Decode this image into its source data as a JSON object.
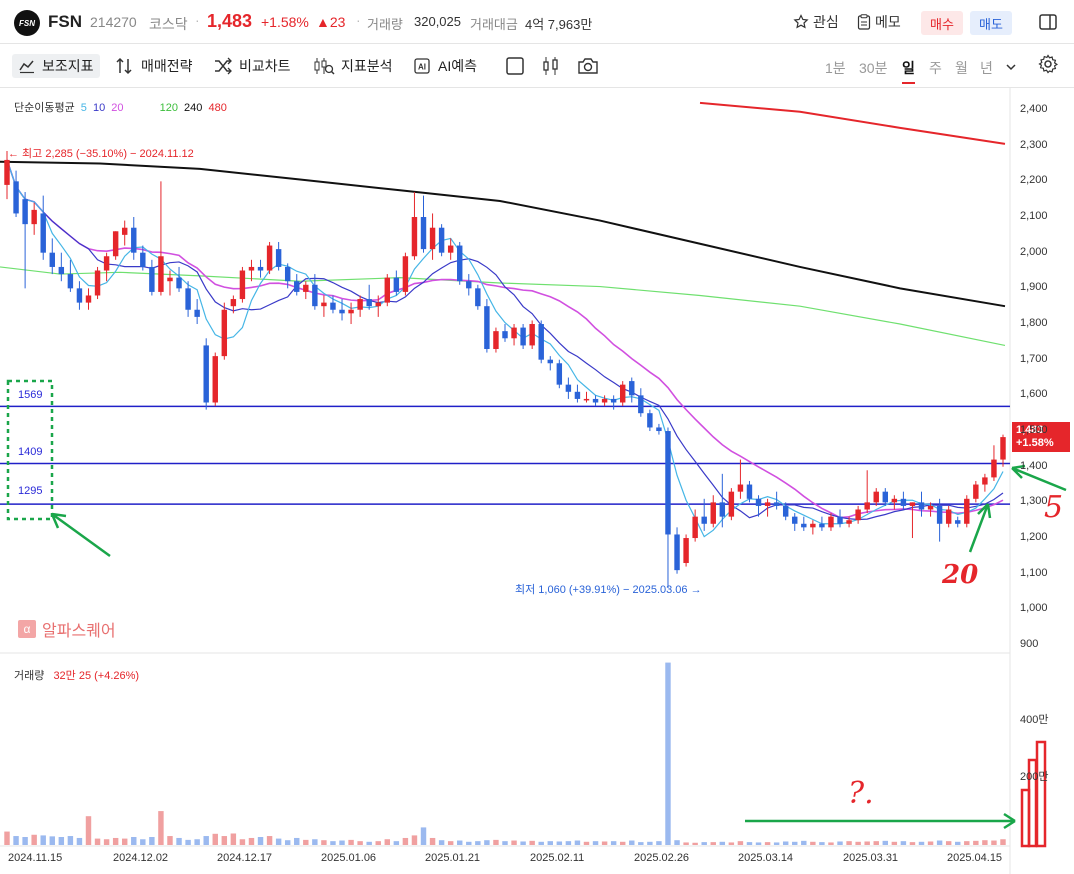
{
  "header": {
    "logo_text": "FSN",
    "name": "FSN",
    "code": "214270",
    "market": "코스닥",
    "price": "1,483",
    "change_pct": "+1.58%",
    "change_diff": "▲23",
    "volume_label": "거래량",
    "volume_value": "320,025",
    "amount_label": "거래대금",
    "amount_value": "4억 7,963만",
    "watch_label": "관심",
    "memo_label": "메모",
    "buy_label": "매수",
    "sell_label": "매도"
  },
  "toolbar": {
    "indicators_label": "보조지표",
    "strategy_label": "매매전략",
    "compare_label": "비교차트",
    "analysis_label": "지표분석",
    "ai_label": "AI예측",
    "periods": [
      "1분",
      "30분",
      "일",
      "주",
      "월",
      "년"
    ],
    "selected_period": "일"
  },
  "legend": {
    "ma_label": "단순이동평균",
    "ma_values": [
      "5",
      "10",
      "20",
      "120",
      "240",
      "480"
    ],
    "volume_label": "거래량",
    "volume_value": "32만 25 (+4.26%)"
  },
  "colors": {
    "up": "#e5262b",
    "down": "#2a63d8",
    "ma5": "#46b6e6",
    "ma10": "#3a3ac8",
    "ma20": "#d150e0",
    "ma120": "#6fe06f",
    "ma240": "#111111",
    "ma480": "#e5262b"
  },
  "annotations": {
    "high": "← 최고 2,285 (−35.10%) − 2024.11.12",
    "low": "최저 1,060 (+39.91%) − 2025.03.06 →",
    "level_1": "1569",
    "level_2": "1409",
    "level_3": "1295",
    "handwritten_5": "5",
    "handwritten_20": "20",
    "handwritten_q": "?.",
    "alpha_brand": "알파스퀘어",
    "alpha_icon": "α"
  },
  "price_tag": {
    "price": "1,483",
    "pct": "+1.58%"
  },
  "price_axis": [
    "2,400",
    "2,300",
    "2,200",
    "2,100",
    "2,000",
    "1,900",
    "1,800",
    "1,700",
    "1,600",
    "1,500",
    "1,400",
    "1,300",
    "1,200",
    "1,100",
    "1,000",
    "900"
  ],
  "volume_axis": [
    "400만",
    "200만"
  ],
  "date_axis": [
    "2024.11.15",
    "2024.12.02",
    "2024.12.17",
    "2025.01.06",
    "2025.01.21",
    "2025.02.11",
    "2025.02.26",
    "2025.03.14",
    "2025.03.31",
    "2025.04.15"
  ],
  "chart_data": {
    "type": "candlestick",
    "price_range": [
      900,
      2400
    ],
    "volume_range_man": [
      0,
      400
    ],
    "horizontal_levels": [
      1569,
      1409,
      1295
    ],
    "candles": [
      {
        "o": 2190,
        "h": 2285,
        "l": 2150,
        "c": 2260
      },
      {
        "o": 2200,
        "h": 2230,
        "l": 2100,
        "c": 2110
      },
      {
        "o": 2150,
        "h": 2170,
        "l": 1900,
        "c": 2080
      },
      {
        "o": 2080,
        "h": 2140,
        "l": 2050,
        "c": 2120
      },
      {
        "o": 2110,
        "h": 2160,
        "l": 1980,
        "c": 2000
      },
      {
        "o": 2000,
        "h": 2040,
        "l": 1940,
        "c": 1960
      },
      {
        "o": 1960,
        "h": 2000,
        "l": 1920,
        "c": 1940
      },
      {
        "o": 1940,
        "h": 1980,
        "l": 1890,
        "c": 1900
      },
      {
        "o": 1900,
        "h": 1920,
        "l": 1840,
        "c": 1860
      },
      {
        "o": 1860,
        "h": 1900,
        "l": 1840,
        "c": 1880
      },
      {
        "o": 1880,
        "h": 1960,
        "l": 1870,
        "c": 1950
      },
      {
        "o": 1950,
        "h": 2000,
        "l": 1920,
        "c": 1990
      },
      {
        "o": 1990,
        "h": 2060,
        "l": 1980,
        "c": 2060
      },
      {
        "o": 2050,
        "h": 2090,
        "l": 2020,
        "c": 2070
      },
      {
        "o": 2070,
        "h": 2100,
        "l": 1980,
        "c": 2000
      },
      {
        "o": 2000,
        "h": 2020,
        "l": 1950,
        "c": 1960
      },
      {
        "o": 1960,
        "h": 1980,
        "l": 1880,
        "c": 1890
      },
      {
        "o": 1890,
        "h": 2200,
        "l": 1880,
        "c": 1990
      },
      {
        "o": 1920,
        "h": 1950,
        "l": 1880,
        "c": 1930
      },
      {
        "o": 1930,
        "h": 1960,
        "l": 1890,
        "c": 1900
      },
      {
        "o": 1900,
        "h": 1920,
        "l": 1820,
        "c": 1840
      },
      {
        "o": 1840,
        "h": 1870,
        "l": 1800,
        "c": 1820
      },
      {
        "o": 1740,
        "h": 1760,
        "l": 1560,
        "c": 1580
      },
      {
        "o": 1580,
        "h": 1720,
        "l": 1570,
        "c": 1710
      },
      {
        "o": 1710,
        "h": 1860,
        "l": 1700,
        "c": 1840
      },
      {
        "o": 1850,
        "h": 1880,
        "l": 1830,
        "c": 1870
      },
      {
        "o": 1870,
        "h": 1960,
        "l": 1860,
        "c": 1950
      },
      {
        "o": 1950,
        "h": 1980,
        "l": 1920,
        "c": 1960
      },
      {
        "o": 1960,
        "h": 1980,
        "l": 1930,
        "c": 1950
      },
      {
        "o": 1950,
        "h": 2030,
        "l": 1940,
        "c": 2020
      },
      {
        "o": 2010,
        "h": 2030,
        "l": 1950,
        "c": 1960
      },
      {
        "o": 1960,
        "h": 1970,
        "l": 1900,
        "c": 1920
      },
      {
        "o": 1920,
        "h": 1940,
        "l": 1880,
        "c": 1890
      },
      {
        "o": 1890,
        "h": 1920,
        "l": 1870,
        "c": 1910
      },
      {
        "o": 1910,
        "h": 1940,
        "l": 1840,
        "c": 1850
      },
      {
        "o": 1850,
        "h": 1880,
        "l": 1820,
        "c": 1860
      },
      {
        "o": 1860,
        "h": 1880,
        "l": 1830,
        "c": 1840
      },
      {
        "o": 1840,
        "h": 1870,
        "l": 1810,
        "c": 1830
      },
      {
        "o": 1830,
        "h": 1860,
        "l": 1800,
        "c": 1840
      },
      {
        "o": 1840,
        "h": 1880,
        "l": 1820,
        "c": 1870
      },
      {
        "o": 1870,
        "h": 1910,
        "l": 1840,
        "c": 1850
      },
      {
        "o": 1850,
        "h": 1880,
        "l": 1820,
        "c": 1860
      },
      {
        "o": 1860,
        "h": 1940,
        "l": 1850,
        "c": 1930
      },
      {
        "o": 1930,
        "h": 1950,
        "l": 1880,
        "c": 1890
      },
      {
        "o": 1890,
        "h": 2000,
        "l": 1880,
        "c": 1990
      },
      {
        "o": 1990,
        "h": 2170,
        "l": 1980,
        "c": 2100
      },
      {
        "o": 2100,
        "h": 2160,
        "l": 2000,
        "c": 2010
      },
      {
        "o": 2010,
        "h": 2110,
        "l": 1980,
        "c": 2070
      },
      {
        "o": 2070,
        "h": 2080,
        "l": 1990,
        "c": 2000
      },
      {
        "o": 2000,
        "h": 2040,
        "l": 1980,
        "c": 2020
      },
      {
        "o": 2020,
        "h": 2030,
        "l": 1910,
        "c": 1920
      },
      {
        "o": 1920,
        "h": 1940,
        "l": 1880,
        "c": 1900
      },
      {
        "o": 1900,
        "h": 1910,
        "l": 1840,
        "c": 1850
      },
      {
        "o": 1850,
        "h": 1870,
        "l": 1720,
        "c": 1730
      },
      {
        "o": 1730,
        "h": 1790,
        "l": 1720,
        "c": 1780
      },
      {
        "o": 1780,
        "h": 1800,
        "l": 1750,
        "c": 1760
      },
      {
        "o": 1760,
        "h": 1800,
        "l": 1740,
        "c": 1790
      },
      {
        "o": 1790,
        "h": 1800,
        "l": 1730,
        "c": 1740
      },
      {
        "o": 1740,
        "h": 1810,
        "l": 1730,
        "c": 1800
      },
      {
        "o": 1800,
        "h": 1810,
        "l": 1690,
        "c": 1700
      },
      {
        "o": 1700,
        "h": 1710,
        "l": 1670,
        "c": 1690
      },
      {
        "o": 1690,
        "h": 1700,
        "l": 1620,
        "c": 1630
      },
      {
        "o": 1630,
        "h": 1650,
        "l": 1590,
        "c": 1610
      },
      {
        "o": 1610,
        "h": 1630,
        "l": 1580,
        "c": 1590
      },
      {
        "o": 1590,
        "h": 1610,
        "l": 1580,
        "c": 1590
      },
      {
        "o": 1590,
        "h": 1600,
        "l": 1570,
        "c": 1580
      },
      {
        "o": 1580,
        "h": 1600,
        "l": 1570,
        "c": 1590
      },
      {
        "o": 1590,
        "h": 1600,
        "l": 1560,
        "c": 1580
      },
      {
        "o": 1580,
        "h": 1640,
        "l": 1570,
        "c": 1630
      },
      {
        "o": 1640,
        "h": 1650,
        "l": 1580,
        "c": 1600
      },
      {
        "o": 1600,
        "h": 1620,
        "l": 1540,
        "c": 1550
      },
      {
        "o": 1550,
        "h": 1560,
        "l": 1500,
        "c": 1510
      },
      {
        "o": 1510,
        "h": 1520,
        "l": 1490,
        "c": 1500
      },
      {
        "o": 1500,
        "h": 1510,
        "l": 1060,
        "c": 1210
      },
      {
        "o": 1210,
        "h": 1230,
        "l": 1100,
        "c": 1110
      },
      {
        "o": 1130,
        "h": 1210,
        "l": 1120,
        "c": 1200
      },
      {
        "o": 1200,
        "h": 1280,
        "l": 1190,
        "c": 1260
      },
      {
        "o": 1260,
        "h": 1310,
        "l": 1220,
        "c": 1240
      },
      {
        "o": 1240,
        "h": 1320,
        "l": 1230,
        "c": 1300
      },
      {
        "o": 1300,
        "h": 1380,
        "l": 1230,
        "c": 1260
      },
      {
        "o": 1260,
        "h": 1340,
        "l": 1250,
        "c": 1330
      },
      {
        "o": 1330,
        "h": 1420,
        "l": 1310,
        "c": 1350
      },
      {
        "o": 1350,
        "h": 1360,
        "l": 1300,
        "c": 1310
      },
      {
        "o": 1310,
        "h": 1320,
        "l": 1260,
        "c": 1290
      },
      {
        "o": 1290,
        "h": 1310,
        "l": 1260,
        "c": 1300
      },
      {
        "o": 1300,
        "h": 1330,
        "l": 1280,
        "c": 1290
      },
      {
        "o": 1290,
        "h": 1300,
        "l": 1250,
        "c": 1260
      },
      {
        "o": 1260,
        "h": 1270,
        "l": 1220,
        "c": 1240
      },
      {
        "o": 1240,
        "h": 1260,
        "l": 1220,
        "c": 1230
      },
      {
        "o": 1230,
        "h": 1250,
        "l": 1210,
        "c": 1240
      },
      {
        "o": 1240,
        "h": 1260,
        "l": 1220,
        "c": 1230
      },
      {
        "o": 1230,
        "h": 1270,
        "l": 1220,
        "c": 1260
      },
      {
        "o": 1260,
        "h": 1280,
        "l": 1230,
        "c": 1240
      },
      {
        "o": 1240,
        "h": 1260,
        "l": 1230,
        "c": 1250
      },
      {
        "o": 1250,
        "h": 1290,
        "l": 1240,
        "c": 1280
      },
      {
        "o": 1280,
        "h": 1390,
        "l": 1270,
        "c": 1300
      },
      {
        "o": 1300,
        "h": 1340,
        "l": 1290,
        "c": 1330
      },
      {
        "o": 1330,
        "h": 1340,
        "l": 1290,
        "c": 1300
      },
      {
        "o": 1300,
        "h": 1320,
        "l": 1280,
        "c": 1310
      },
      {
        "o": 1310,
        "h": 1330,
        "l": 1280,
        "c": 1290
      },
      {
        "o": 1290,
        "h": 1300,
        "l": 1200,
        "c": 1300
      },
      {
        "o": 1300,
        "h": 1330,
        "l": 1260,
        "c": 1280
      },
      {
        "o": 1280,
        "h": 1300,
        "l": 1260,
        "c": 1290
      },
      {
        "o": 1290,
        "h": 1310,
        "l": 1190,
        "c": 1240
      },
      {
        "o": 1240,
        "h": 1290,
        "l": 1230,
        "c": 1280
      },
      {
        "o": 1250,
        "h": 1260,
        "l": 1230,
        "c": 1240
      },
      {
        "o": 1240,
        "h": 1320,
        "l": 1230,
        "c": 1310
      },
      {
        "o": 1310,
        "h": 1360,
        "l": 1300,
        "c": 1350
      },
      {
        "o": 1350,
        "h": 1380,
        "l": 1330,
        "c": 1370
      },
      {
        "o": 1370,
        "h": 1460,
        "l": 1360,
        "c": 1420
      },
      {
        "o": 1420,
        "h": 1490,
        "l": 1400,
        "c": 1483
      }
    ],
    "volumes_man": [
      42,
      28,
      25,
      32,
      30,
      27,
      25,
      28,
      22,
      90,
      20,
      18,
      22,
      20,
      25,
      18,
      25,
      106,
      28,
      22,
      16,
      18,
      28,
      35,
      28,
      36,
      18,
      22,
      25,
      28,
      20,
      15,
      22,
      16,
      18,
      15,
      12,
      14,
      16,
      12,
      10,
      12,
      18,
      12,
      22,
      30,
      55,
      22,
      15,
      12,
      14,
      10,
      12,
      15,
      16,
      12,
      14,
      11,
      13,
      10,
      12,
      11,
      12,
      14,
      10,
      12,
      11,
      12,
      10,
      14,
      9,
      10,
      12,
      18,
      15,
      8,
      7,
      9,
      9,
      10,
      8,
      12,
      9,
      8,
      9,
      8,
      11,
      10,
      13,
      10,
      9,
      8,
      11,
      12,
      10,
      11,
      12,
      13,
      10,
      12,
      9,
      10,
      11,
      14,
      12,
      10,
      12,
      13,
      15,
      14,
      18
    ],
    "volume_big_index": 73,
    "volume_big_man": 570,
    "ma120_points": [
      [
        0,
        1960
      ],
      [
        60,
        1940
      ],
      [
        120,
        1945
      ],
      [
        200,
        1935
      ],
      [
        300,
        1920
      ],
      [
        400,
        1930
      ],
      [
        500,
        1915
      ],
      [
        600,
        1905
      ],
      [
        700,
        1880
      ],
      [
        800,
        1850
      ],
      [
        900,
        1800
      ],
      [
        1005,
        1740
      ]
    ],
    "ma240_points": [
      [
        0,
        2255
      ],
      [
        100,
        2250
      ],
      [
        200,
        2235
      ],
      [
        300,
        2205
      ],
      [
        400,
        2175
      ],
      [
        500,
        2145
      ],
      [
        600,
        2090
      ],
      [
        700,
        2025
      ],
      [
        800,
        1960
      ],
      [
        900,
        1900
      ],
      [
        1005,
        1850
      ]
    ],
    "ma480_points": [
      [
        700,
        2420
      ],
      [
        800,
        2395
      ],
      [
        900,
        2350
      ],
      [
        1005,
        2305
      ]
    ]
  }
}
